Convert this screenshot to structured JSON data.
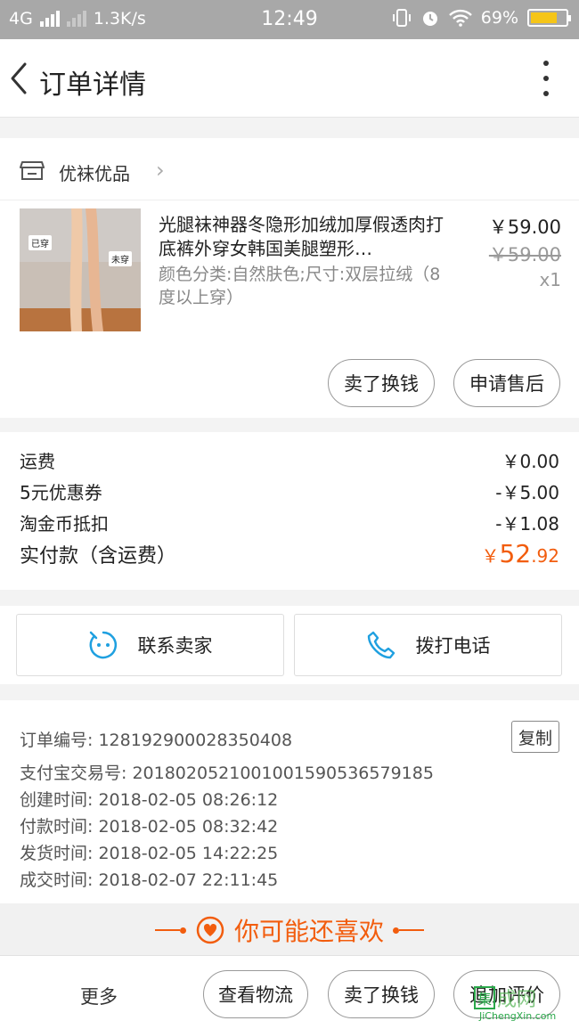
{
  "status_bar": {
    "network": "4G",
    "speed": "1.3K/s",
    "time": "12:49",
    "battery": "69%"
  },
  "header": {
    "title": "订单详情"
  },
  "shop": {
    "name": "优袜优品"
  },
  "product": {
    "name": "光腿袜神器冬隐形加绒加厚假透肉打底裤外穿女韩国美腿塑形…",
    "spec": "颜色分类:自然肤色;尺寸:双层拉绒（8度以上穿）",
    "price": "￥59.00",
    "original_price": "￥59.00",
    "quantity": "x1",
    "image_labels": {
      "left": "已穿",
      "right": "未穿"
    }
  },
  "product_actions": {
    "sell_exchange": "卖了换钱",
    "after_sales": "申请售后"
  },
  "fees": {
    "shipping_label": "运费",
    "shipping_value": "￥0.00",
    "coupon_label": "5元优惠券",
    "coupon_value": "-￥5.00",
    "coins_label": "淘金币抵扣",
    "coins_value": "-￥1.08",
    "total_label": "实付款（含运费）",
    "total_currency": "￥",
    "total_int": "52",
    "total_dec": ".92"
  },
  "contact": {
    "seller_label": "联系卖家",
    "phone_label": "拨打电话"
  },
  "order_info": {
    "order_no_label": "订单编号:",
    "order_no": "128192900028350408",
    "copy_label": "复制",
    "alipay_label": "支付宝交易号:",
    "alipay_no": "2018020521001001590536579185",
    "created_label": "创建时间:",
    "created": "2018-02-05 08:26:12",
    "paid_label": "付款时间:",
    "paid": "2018-02-05 08:32:42",
    "shipped_label": "发货时间:",
    "shipped": "2018-02-05 14:22:25",
    "completed_label": "成交时间:",
    "completed": "2018-02-07 22:11:45"
  },
  "recommend": {
    "title": "你可能还喜欢"
  },
  "bottom_bar": {
    "more": "更多",
    "logistics": "查看物流",
    "sell_exchange": "卖了换钱",
    "review": "追加评价"
  },
  "watermark": {
    "box_char": "集",
    "text": "成网",
    "url": "JiChengXin.com"
  },
  "colors": {
    "accent": "#f25d0e",
    "contact_icon": "#1fa0e0",
    "status_bar": "#a8a8a8"
  }
}
